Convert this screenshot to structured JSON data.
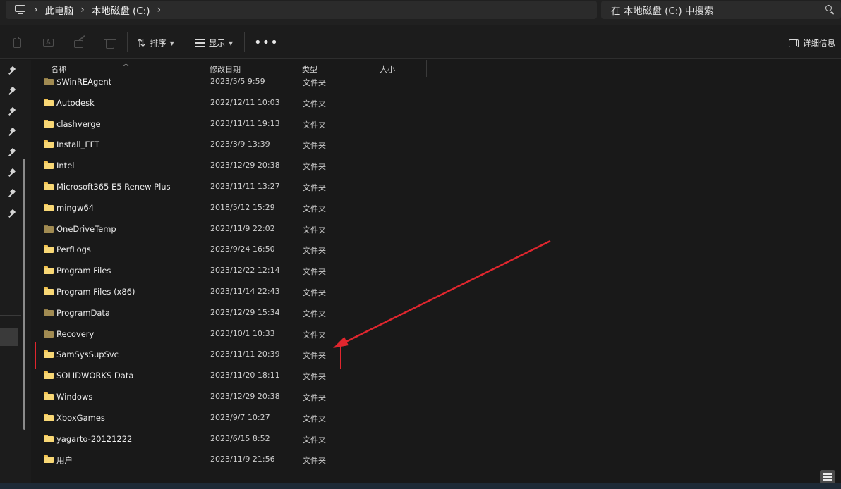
{
  "address": {
    "breadcrumbs": [
      "此电脑",
      "本地磁盘 (C:)"
    ]
  },
  "search": {
    "placeholder": "在 本地磁盘 (C:) 中搜索"
  },
  "toolbar": {
    "sort_label": "排序",
    "view_label": "显示",
    "details_label": "详细信息"
  },
  "columns": {
    "name": "名称",
    "modified": "修改日期",
    "type": "类型",
    "size": "大小"
  },
  "files": [
    {
      "name": "$WinREAgent",
      "date": "2023/5/5 9:59",
      "type": "文件夹",
      "dim": true
    },
    {
      "name": "Autodesk",
      "date": "2022/12/11 10:03",
      "type": "文件夹"
    },
    {
      "name": "clashverge",
      "date": "2023/11/11 19:13",
      "type": "文件夹"
    },
    {
      "name": "Install_EFT",
      "date": "2023/3/9 13:39",
      "type": "文件夹"
    },
    {
      "name": "Intel",
      "date": "2023/12/29 20:38",
      "type": "文件夹"
    },
    {
      "name": "Microsoft365 E5 Renew Plus",
      "date": "2023/11/11 13:27",
      "type": "文件夹"
    },
    {
      "name": "mingw64",
      "date": "2018/5/12 15:29",
      "type": "文件夹"
    },
    {
      "name": "OneDriveTemp",
      "date": "2023/11/9 22:02",
      "type": "文件夹",
      "dim": true
    },
    {
      "name": "PerfLogs",
      "date": "2023/9/24 16:50",
      "type": "文件夹"
    },
    {
      "name": "Program Files",
      "date": "2023/12/22 12:14",
      "type": "文件夹"
    },
    {
      "name": "Program Files (x86)",
      "date": "2023/11/14 22:43",
      "type": "文件夹"
    },
    {
      "name": "ProgramData",
      "date": "2023/12/29 15:34",
      "type": "文件夹",
      "dim": true
    },
    {
      "name": "Recovery",
      "date": "2023/10/1 10:33",
      "type": "文件夹",
      "dim": true
    },
    {
      "name": "SamSysSupSvc",
      "date": "2023/11/11 20:39",
      "type": "文件夹",
      "highlighted": true
    },
    {
      "name": "SOLIDWORKS Data",
      "date": "2023/11/20 18:11",
      "type": "文件夹"
    },
    {
      "name": "Windows",
      "date": "2023/12/29 20:38",
      "type": "文件夹"
    },
    {
      "name": "XboxGames",
      "date": "2023/9/7 10:27",
      "type": "文件夹"
    },
    {
      "name": "yagarto-20121222",
      "date": "2023/6/15 8:52",
      "type": "文件夹"
    },
    {
      "name": "用户",
      "date": "2023/11/9 21:56",
      "type": "文件夹"
    }
  ],
  "annotation": {
    "color": "#e0262e"
  }
}
